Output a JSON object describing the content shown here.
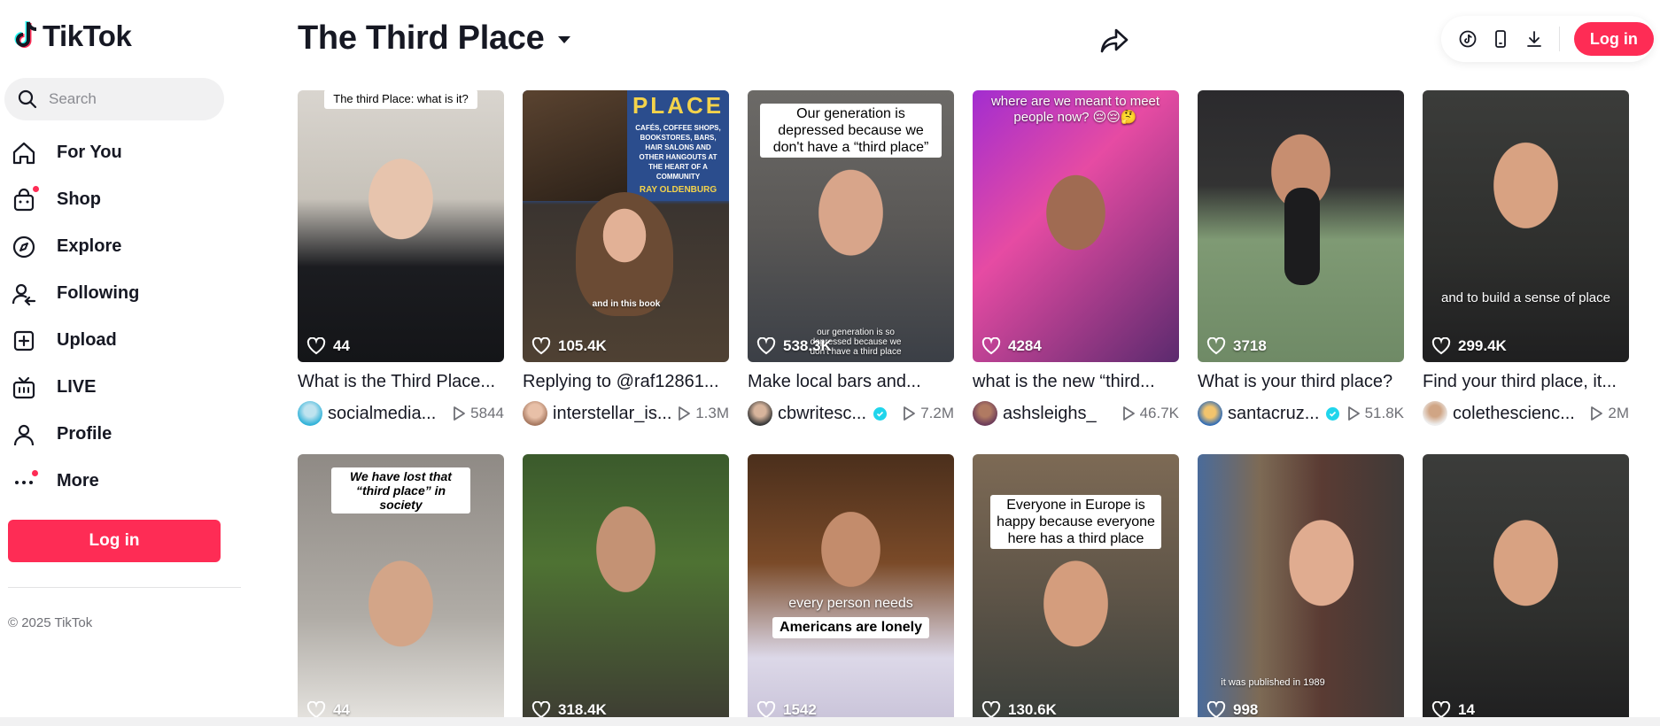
{
  "brand": {
    "name": "TikTok",
    "accent": "#fe2c55"
  },
  "search": {
    "placeholder": "Search"
  },
  "nav": [
    {
      "label": "For You",
      "icon": "home-icon"
    },
    {
      "label": "Shop",
      "icon": "shopping-bag-icon",
      "dot": true
    },
    {
      "label": "Explore",
      "icon": "compass-icon"
    },
    {
      "label": "Following",
      "icon": "following-icon"
    },
    {
      "label": "Upload",
      "icon": "upload-icon"
    },
    {
      "label": "LIVE",
      "icon": "live-tv-icon"
    },
    {
      "label": "Profile",
      "icon": "profile-icon"
    },
    {
      "label": "More",
      "icon": "more-dots-icon",
      "dot": true
    }
  ],
  "sidebar": {
    "login_label": "Log in",
    "copyright": "© 2025 TikTok"
  },
  "header": {
    "title": "The Third Place",
    "login_label": "Log in"
  },
  "videos": [
    {
      "likes": "44",
      "title": "What is the Third Place...",
      "author": "socialmedia...",
      "views": "5844",
      "verified": false,
      "overlay": "The third Place: what is it?"
    },
    {
      "likes": "105.4K",
      "title": "Replying to @raf12861...",
      "author": "interstellar_is...",
      "views": "1.3M",
      "verified": false,
      "overlay": "and in this book",
      "book": "PLACE",
      "book_text": "CAFÉS, COFFEE SHOPS, BOOKSTORES, BARS, HAIR SALONS AND OTHER HANGOUTS AT THE HEART OF A COMMUNITY",
      "book_author": "RAY OLDENBURG"
    },
    {
      "likes": "538.3K",
      "title": "Make local bars and...",
      "author": "cbwritesc...",
      "views": "7.2M",
      "verified": true,
      "overlay": "Our generation is depressed because we don't have a “third place”",
      "overlay2": "our generation is so depressed because we don't have a third place"
    },
    {
      "likes": "4284",
      "title": "what is the new “third...",
      "author": "ashsleighs_",
      "views": "46.7K",
      "verified": false,
      "overlay": "where are we meant to meet people now? 😔😔🤔"
    },
    {
      "likes": "3718",
      "title": "What is your third place?",
      "author": "santacruz...",
      "views": "51.8K",
      "verified": true,
      "overlay": ""
    },
    {
      "likes": "299.4K",
      "title": "Find your third place, it...",
      "author": "colethescienc...",
      "views": "2M",
      "verified": false,
      "overlay": "and to build a sense of place"
    },
    {
      "likes": "44",
      "title": "",
      "author": "",
      "views": "",
      "verified": false,
      "overlay": "We have lost that “third place” in society"
    },
    {
      "likes": "318.4K",
      "title": "",
      "author": "",
      "views": "",
      "verified": false,
      "overlay": ""
    },
    {
      "likes": "1542",
      "title": "",
      "author": "",
      "views": "",
      "verified": false,
      "overlay": "every person needs",
      "overlay2": "Americans are lonely"
    },
    {
      "likes": "130.6K",
      "title": "",
      "author": "",
      "views": "",
      "verified": false,
      "overlay": "Everyone in Europe is happy because everyone here has a third place"
    },
    {
      "likes": "998",
      "title": "",
      "author": "",
      "views": "",
      "verified": false,
      "overlay": "it was published in 1989"
    },
    {
      "likes": "14",
      "title": "",
      "author": "",
      "views": "",
      "verified": false,
      "overlay": ""
    }
  ]
}
